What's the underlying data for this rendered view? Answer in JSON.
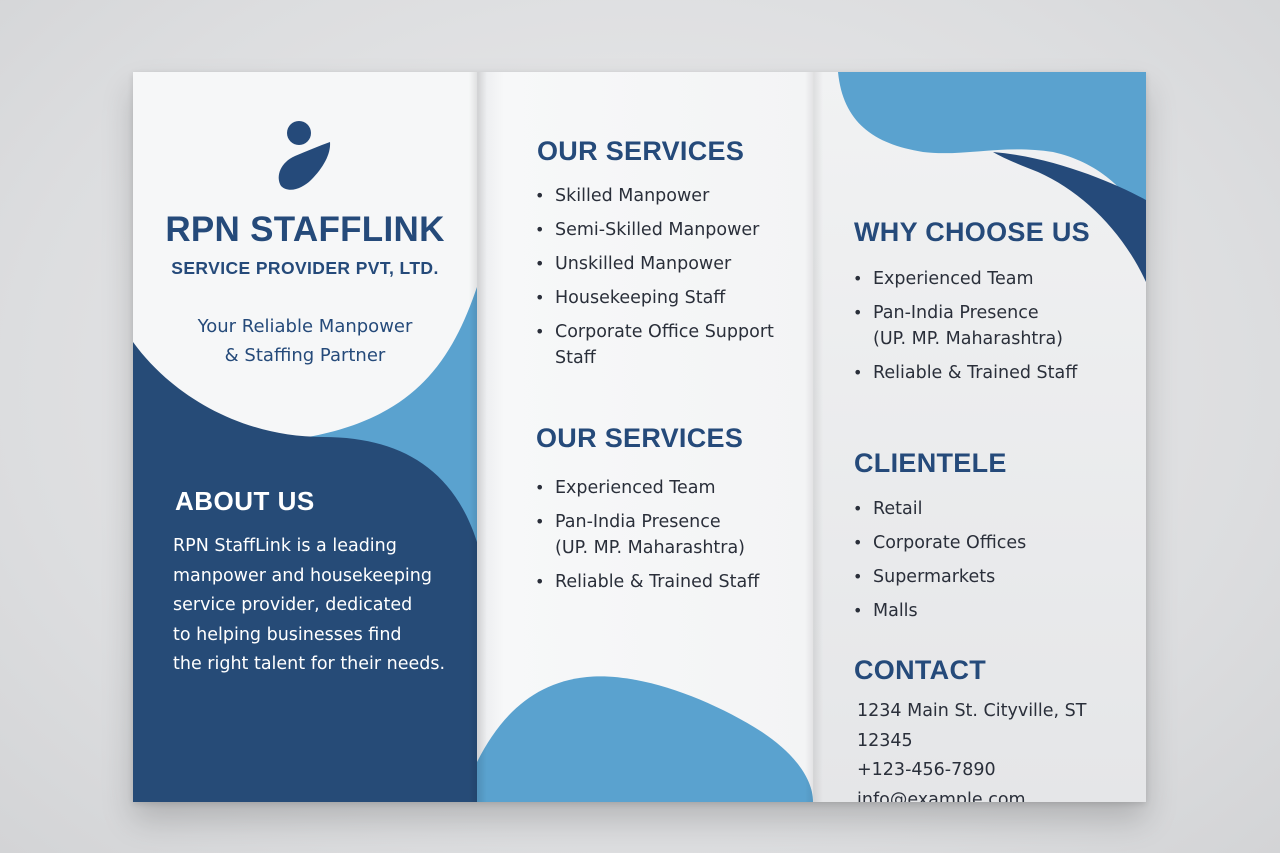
{
  "colors": {
    "navy": "#254a7a",
    "deep_blue": "#264b77",
    "light_blue": "#5aa2cf",
    "paper": "#f6f7f8",
    "text": "#2a2f3a"
  },
  "cover": {
    "logo_icon": "person-figure-icon",
    "brand": "RPN STAFFLINK",
    "brand_sub": "SERVICE PROVIDER PVT, LTD.",
    "tagline_lines": [
      "Your Reliable Manpower",
      "& Staffing Partner"
    ],
    "about_heading": "ABOUT US",
    "about_lines": [
      "RPN StaffLink is a leading",
      "manpower and housekeeping",
      "service provider, dedicated",
      "to helping businesses find",
      "the right talent for their needs."
    ]
  },
  "middle": {
    "services1_heading": "OUR SERVICES",
    "services1_items": [
      "Skilled Manpower",
      "Semi-Skilled Manpower",
      "Unskilled Manpower",
      "Housekeeping Staff",
      "Corporate Office Support Staff"
    ],
    "services2_heading": "OUR SERVICES",
    "services2_items": [
      "Experienced Team",
      "Pan-India Presence (UP. MP. Maharashtra)",
      "Reliable & Trained Staff"
    ]
  },
  "right": {
    "why_heading": "WHY CHOOSE US",
    "why_items": [
      "Experienced Team",
      "Pan-India Presence (UP. MP. Maharashtra)",
      "Reliable & Trained Staff"
    ],
    "clientele_heading": "CLIENTELE",
    "clientele_items": [
      "Retail",
      "Corporate Offices",
      "Supermarkets",
      "Malls"
    ],
    "contact_heading": "CONTACT",
    "contact_address": "1234 Main St. Cityville, ST 12345",
    "contact_phone": "+123-456-7890",
    "contact_email": "info@example.com"
  }
}
